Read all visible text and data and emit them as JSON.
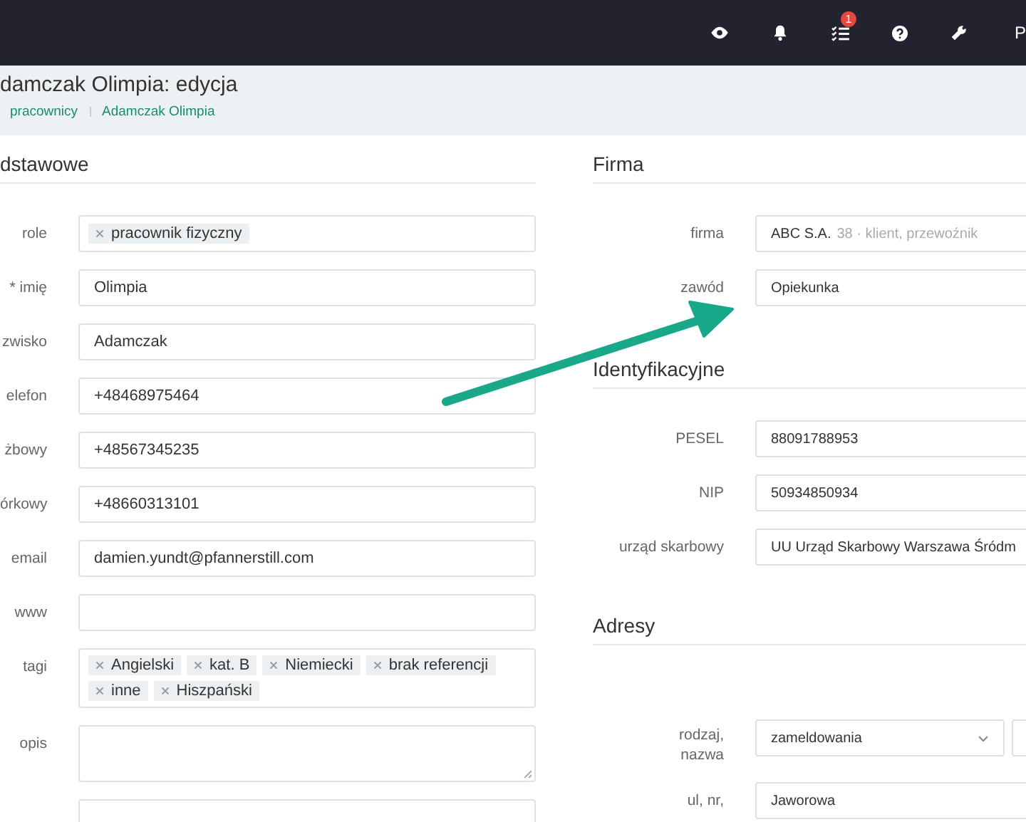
{
  "topbar": {
    "icons": [
      {
        "kind": "eye"
      },
      {
        "kind": "bell"
      },
      {
        "kind": "tasks",
        "badge": "1"
      },
      {
        "kind": "help"
      },
      {
        "kind": "wrench"
      }
    ],
    "user_initial": "P"
  },
  "page_header": {
    "title": "damczak Olimpia: edycja",
    "breadcrumbs": [
      "pracownicy",
      "Adamczak Olimpia"
    ]
  },
  "left_section": {
    "title": "dstawowe",
    "fields": [
      {
        "kind": "tags",
        "label": "role",
        "tags": [
          "pracownik fizyczny"
        ]
      },
      {
        "kind": "text",
        "label": "* imię",
        "value": "Olimpia"
      },
      {
        "kind": "text",
        "label": "zwisko",
        "value": "Adamczak"
      },
      {
        "kind": "text",
        "label": "elefon",
        "value": "+48468975464"
      },
      {
        "kind": "text",
        "label": "żbowy",
        "value": "+48567345235"
      },
      {
        "kind": "text",
        "label": "órkowy",
        "value": "+48660313101"
      },
      {
        "kind": "text",
        "label": "email",
        "value": "damien.yundt@pfannerstill.com"
      },
      {
        "kind": "text",
        "label": "www"
      },
      {
        "kind": "tags",
        "label": "tagi",
        "tags": [
          "Angielski",
          "kat. B",
          "Niemiecki",
          "brak referencji",
          "inne",
          "Hiszpański"
        ]
      },
      {
        "kind": "textarea",
        "label": "opis"
      },
      {
        "kind": "blank"
      }
    ]
  },
  "right_sections": [
    {
      "title": "Firma",
      "fields": [
        {
          "kind": "company",
          "label": "firma",
          "value": "ABC S.A.",
          "hint": "38 · klient, przewoźnik"
        },
        {
          "kind": "text",
          "label": "zawód",
          "value": "Opiekunka"
        }
      ]
    },
    {
      "title": "Identyfikacyjne",
      "fields": [
        {
          "kind": "text",
          "label": "PESEL",
          "value": "88091788953"
        },
        {
          "kind": "text",
          "label": "NIP",
          "value": "50934850934"
        },
        {
          "kind": "text",
          "label": "urząd skarbowy",
          "value": "UU Urząd Skarbowy Warszawa Śródm"
        }
      ]
    },
    {
      "title": "Adresy",
      "fields": [
        {
          "kind": "select_pair",
          "label": "rodzaj, nazwa",
          "value": "zameldowania"
        },
        {
          "kind": "text",
          "label": "ul, nr,",
          "value": "Jaworowa"
        }
      ]
    }
  ]
}
